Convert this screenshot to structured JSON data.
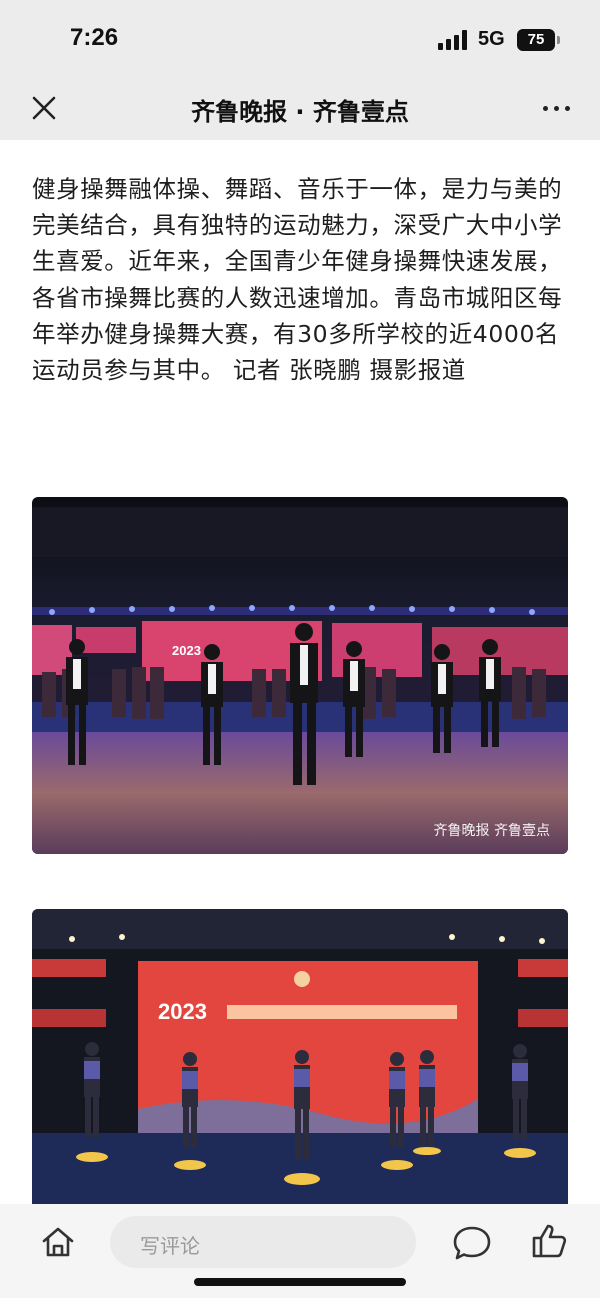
{
  "status_bar": {
    "time": "7:26",
    "network": "5G",
    "battery": "75"
  },
  "nav": {
    "title": "齐鲁晚报 · 齐鲁壹点",
    "close_icon": "close-icon",
    "more_icon": "more-icon"
  },
  "article": {
    "paragraph": "健身操舞融体操、舞蹈、音乐于一体，是力与美的完美结合，具有独特的运动魅力，深受广大中小学生喜爱。近年来，全国青少年健身操舞快速发展，各省市操舞比赛的人数迅速增加。青岛市城阳区每年举办健身操舞大赛，有30多所学校的近4000名运动员参与其中。 记者 张晓鹏 摄影报道",
    "photos": [
      {
        "watermark": "齐鲁晚报 齐鲁壹点"
      },
      {
        "banner_year": "2023"
      }
    ]
  },
  "bottom_bar": {
    "comment_placeholder": "写评论",
    "home_icon": "home-icon",
    "chat_icon": "chat-bubble-icon",
    "like_icon": "thumbs-up-icon"
  }
}
